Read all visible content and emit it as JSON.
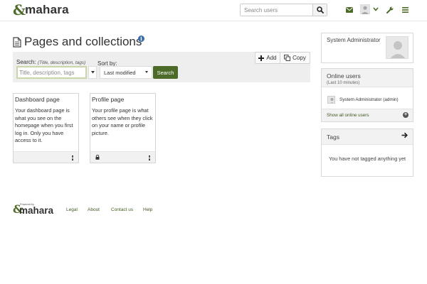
{
  "header": {
    "logo_text": "mahara",
    "search_placeholder": "Search users",
    "icons": [
      "envelope-icon",
      "user-avatar-icon",
      "chevron-down-icon",
      "wrench-icon",
      "hamburger-menu-icon"
    ]
  },
  "main": {
    "title": "Pages and collections",
    "search": {
      "label": "Search:",
      "hint": "(Title, description, tags)",
      "placeholder": "Title, description, tags",
      "sort_label": "Sort by:",
      "sort_value": "Last modified",
      "submit_label": "Search"
    },
    "actions": {
      "add_label": "Add",
      "copy_label": "Copy"
    },
    "cards": [
      {
        "title": "Dashboard page",
        "description": "Your dashboard page is what you see on the homepage when you first log in. Only you have access to it."
      },
      {
        "title": "Profile page",
        "description": "Your profile page is what others see when they click on your name or profile picture."
      }
    ]
  },
  "sidebar": {
    "profile_name": "System Administrator",
    "online": {
      "title": "Online users",
      "subtitle": "(Last 10 minutes)",
      "user": "System Administrator (admin)",
      "footer_link": "Show all online users"
    },
    "tags": {
      "title": "Tags",
      "empty": "You have not tagged anything yet"
    }
  },
  "footer": {
    "powered_by": "Powered by",
    "logo_text": "mahara",
    "links": [
      "Legal",
      "About",
      "Contact us",
      "Help"
    ]
  },
  "colors": {
    "brand_green": "#4c6b28",
    "link_green": "#3f5a1f",
    "panel_grey": "#eeeeee"
  }
}
